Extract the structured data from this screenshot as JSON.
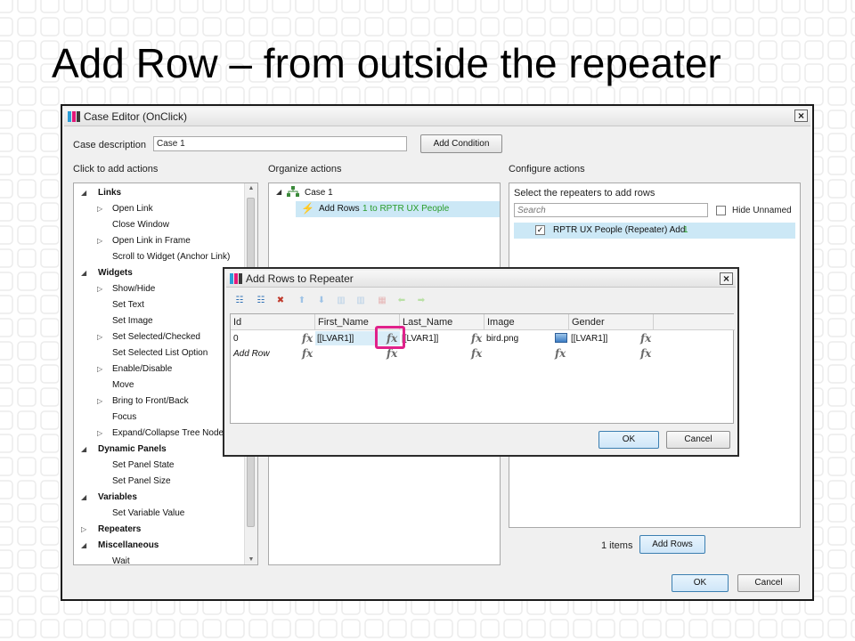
{
  "slide": {
    "title": "Add Row – from outside the repeater"
  },
  "colors": {
    "accent": "#3c7fb1",
    "highlight": "#e0218a",
    "selection": "#cce8f6",
    "green_text": "#2a9c2a"
  },
  "case_editor": {
    "title": "Case Editor (OnClick)",
    "close_glyph": "×",
    "case_description_label": "Case description",
    "case_description_value": "Case 1",
    "add_condition": "Add Condition",
    "click_to_add_label": "Click to add actions",
    "organize_label": "Organize actions",
    "configure_label": "Configure actions",
    "actions_tree": [
      {
        "label": "Links",
        "level": 0,
        "expander": "open"
      },
      {
        "label": "Open Link",
        "level": 1,
        "expander": "closed"
      },
      {
        "label": "Close Window",
        "level": 1,
        "expander": ""
      },
      {
        "label": "Open Link in Frame",
        "level": 1,
        "expander": "closed"
      },
      {
        "label": "Scroll to Widget (Anchor Link)",
        "level": 1,
        "expander": ""
      },
      {
        "label": "Widgets",
        "level": 0,
        "expander": "open"
      },
      {
        "label": "Show/Hide",
        "level": 1,
        "expander": "closed"
      },
      {
        "label": "Set Text",
        "level": 1,
        "expander": ""
      },
      {
        "label": "Set Image",
        "level": 1,
        "expander": ""
      },
      {
        "label": "Set Selected/Checked",
        "level": 1,
        "expander": "closed"
      },
      {
        "label": "Set Selected List Option",
        "level": 1,
        "expander": ""
      },
      {
        "label": "Enable/Disable",
        "level": 1,
        "expander": "closed"
      },
      {
        "label": "Move",
        "level": 1,
        "expander": ""
      },
      {
        "label": "Bring to Front/Back",
        "level": 1,
        "expander": "closed"
      },
      {
        "label": "Focus",
        "level": 1,
        "expander": ""
      },
      {
        "label": "Expand/Collapse Tree Node",
        "level": 1,
        "expander": "closed"
      },
      {
        "label": "Dynamic Panels",
        "level": 0,
        "expander": "open"
      },
      {
        "label": "Set Panel State",
        "level": 1,
        "expander": ""
      },
      {
        "label": "Set Panel Size",
        "level": 1,
        "expander": ""
      },
      {
        "label": "Variables",
        "level": 0,
        "expander": "open"
      },
      {
        "label": "Set Variable Value",
        "level": 1,
        "expander": ""
      },
      {
        "label": "Repeaters",
        "level": 0,
        "expander": "closed"
      },
      {
        "label": "Miscellaneous",
        "level": 0,
        "expander": "open"
      },
      {
        "label": "Wait",
        "level": 1,
        "expander": ""
      }
    ],
    "organize": {
      "case_label": "Case 1",
      "action_prefix": "Add Rows ",
      "action_suffix": "1 to RPTR UX People"
    },
    "configure": {
      "select_label": "Select the repeaters to add rows",
      "search_placeholder": "Search",
      "hide_unnamed": "Hide Unnamed",
      "repeater_item_prefix": "RPTR UX People (Repeater) Add ",
      "repeater_item_count": "1",
      "repeater_checked": true,
      "items_count_text": "1 items",
      "add_rows_button": "Add Rows"
    },
    "ok": "OK",
    "cancel": "Cancel"
  },
  "add_rows_dialog": {
    "title": "Add Rows to Repeater",
    "close_glyph": "×",
    "columns": [
      "Id",
      "First_Name",
      "Last_Name",
      "Image",
      "Gender"
    ],
    "row1": {
      "id": "0",
      "first_name": "[[LVAR1]]",
      "last_name": "[[LVAR1]]",
      "image": "bird.png",
      "gender": "[[LVAR1]]"
    },
    "row2_label": "Add Row",
    "fx_glyph": "fx",
    "ok": "OK",
    "cancel": "Cancel"
  }
}
